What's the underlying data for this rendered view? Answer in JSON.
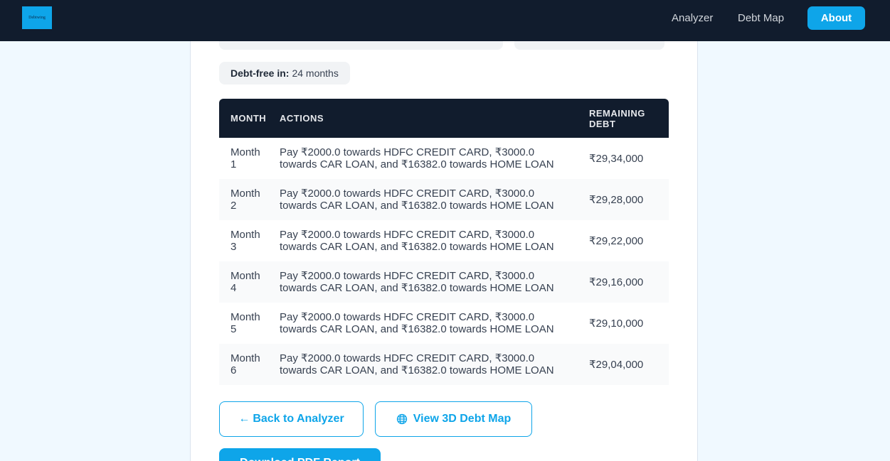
{
  "nav": {
    "logo_text": "Debtwing",
    "links": [
      "Analyzer",
      "Debt Map"
    ],
    "about_label": "About"
  },
  "summary": {
    "debt_free_label": "Debt-free in:",
    "debt_free_value": "24 months"
  },
  "table": {
    "headers": [
      "MONTH",
      "ACTIONS",
      "REMAINING DEBT"
    ],
    "rows": [
      {
        "month": "Month 1",
        "action": "Pay ₹2000.0 towards HDFC CREDIT CARD, ₹3000.0 towards CAR LOAN, and ₹16382.0 towards HOME LOAN",
        "remaining": "₹29,34,000"
      },
      {
        "month": "Month 2",
        "action": "Pay ₹2000.0 towards HDFC CREDIT CARD, ₹3000.0 towards CAR LOAN, and ₹16382.0 towards HOME LOAN",
        "remaining": "₹29,28,000"
      },
      {
        "month": "Month 3",
        "action": "Pay ₹2000.0 towards HDFC CREDIT CARD, ₹3000.0 towards CAR LOAN, and ₹16382.0 towards HOME LOAN",
        "remaining": "₹29,22,000"
      },
      {
        "month": "Month 4",
        "action": "Pay ₹2000.0 towards HDFC CREDIT CARD, ₹3000.0 towards CAR LOAN, and ₹16382.0 towards HOME LOAN",
        "remaining": "₹29,16,000"
      },
      {
        "month": "Month 5",
        "action": "Pay ₹2000.0 towards HDFC CREDIT CARD, ₹3000.0 towards CAR LOAN, and ₹16382.0 towards HOME LOAN",
        "remaining": "₹29,10,000"
      },
      {
        "month": "Month 6",
        "action": "Pay ₹2000.0 towards HDFC CREDIT CARD, ₹3000.0 towards CAR LOAN, and ₹16382.0 towards HOME LOAN",
        "remaining": "₹29,04,000"
      }
    ]
  },
  "actions": {
    "back_label": "Back to Analyzer",
    "back_arrow": "←",
    "map_label": "View 3D Debt Map",
    "pdf_label": "Download PDF Report"
  },
  "icons": {
    "back": "arrow-left-icon",
    "map": "globe-icon"
  },
  "colors": {
    "accent": "#0ea5e9",
    "navbar": "#111c2d",
    "background": "#f0f9ff"
  }
}
